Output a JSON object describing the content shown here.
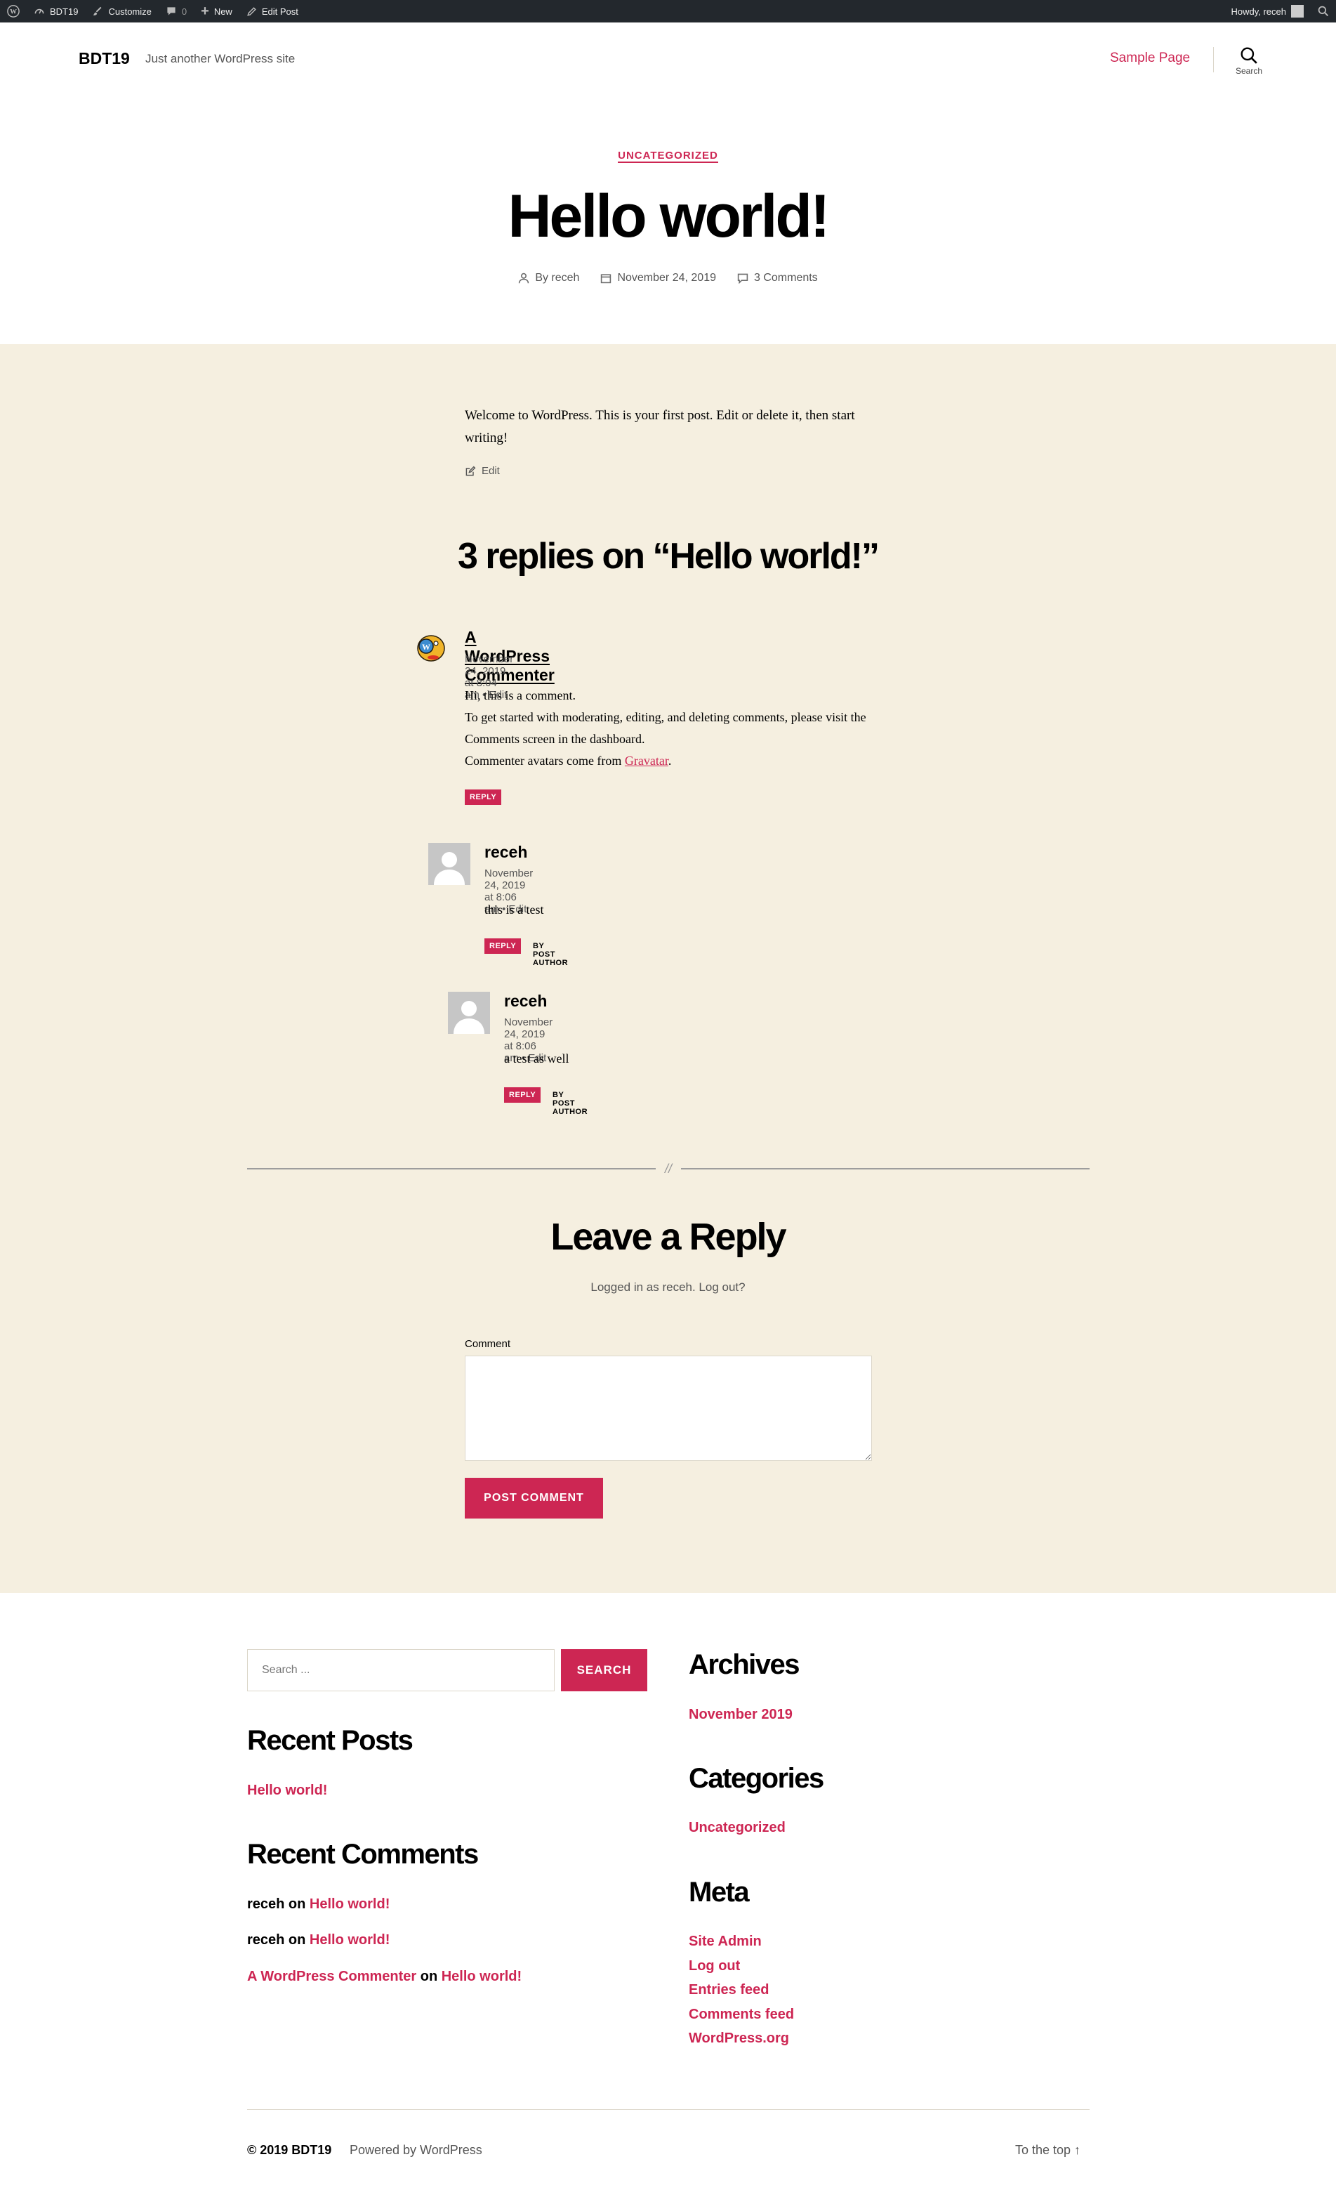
{
  "admin_bar": {
    "site_name": "BDT19",
    "customize": "Customize",
    "comments_count": "0",
    "new_label": "New",
    "edit_post": "Edit Post",
    "howdy": "Howdy, receh"
  },
  "header": {
    "site_title": "BDT19",
    "site_description": "Just another WordPress site",
    "nav_link": "Sample Page",
    "search_label": "Search"
  },
  "post": {
    "category": "UNCATEGORIZED",
    "title": "Hello world!",
    "author": "By receh",
    "date": "November 24, 2019",
    "comments_link": "3 Comments",
    "content": "Welcome to WordPress. This is your first post. Edit or delete it, then start writing!",
    "edit_label": "Edit"
  },
  "comments": {
    "title": "3 replies on “Hello world!”",
    "items": [
      {
        "author": "A WordPress Commenter",
        "meta": "November 24, 2019 at 8:04 am • Edit",
        "lines": [
          "Hi, this is a comment.",
          "To get started with moderating, editing, and deleting comments, please visit the Comments screen in the dashboard.",
          "Commenter avatars come from "
        ],
        "link_text": "Gravatar",
        "after_link": ".",
        "reply": "REPLY"
      },
      {
        "author": "receh",
        "meta": "November 24, 2019 at 8:06 am • Edit",
        "text": "this is a test",
        "reply": "REPLY",
        "badge": "BY POST AUTHOR"
      },
      {
        "author": "receh",
        "meta": "November 24, 2019 at 8:06 am • Edit",
        "text": "a test as well",
        "reply": "REPLY",
        "badge": "BY POST AUTHOR"
      }
    ]
  },
  "reply_form": {
    "divider_mark": "//",
    "title": "Leave a Reply",
    "logged_in": "Logged in as receh. Log out?",
    "comment_label": "Comment",
    "submit": "POST COMMENT"
  },
  "widgets": {
    "search_placeholder": "Search ...",
    "search_button": "SEARCH",
    "recent_posts_title": "Recent Posts",
    "recent_posts": [
      "Hello world!"
    ],
    "recent_comments_title": "Recent Comments",
    "recent_comments": [
      {
        "who": "receh",
        "on": " on ",
        "post": "Hello world!"
      },
      {
        "who": "receh",
        "on": " on ",
        "post": "Hello world!"
      },
      {
        "who": "A WordPress Commenter",
        "on": " on ",
        "post": "Hello world!"
      }
    ],
    "archives_title": "Archives",
    "archives": [
      "November 2019"
    ],
    "categories_title": "Categories",
    "categories": [
      "Uncategorized"
    ],
    "meta_title": "Meta",
    "meta": [
      "Site Admin",
      "Log out",
      "Entries feed",
      "Comments feed",
      "WordPress.org"
    ]
  },
  "footer": {
    "copyright": "© 2019 BDT19",
    "powered": "Powered by WordPress",
    "to_top": "To the top ↑"
  },
  "colors": {
    "accent": "#cd2653",
    "beige": "#f5efe0",
    "admin_bar": "#23282d"
  }
}
